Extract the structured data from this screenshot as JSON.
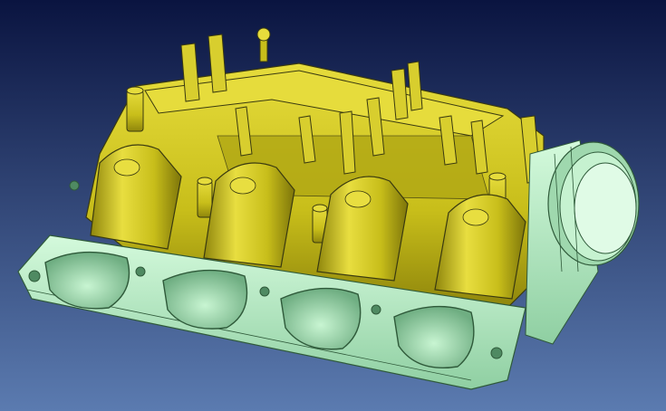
{
  "scene": {
    "subject": "intake-manifold-cad-model",
    "background_top": "#0a1440",
    "background_bottom": "#5b7bb0",
    "plastic_color": "#c8be1a",
    "plastic_shade": "#8f860c",
    "plastic_light": "#e6dc3c",
    "flange_color": "#b9f0c6",
    "flange_shade": "#7fc494",
    "edge_color": "#3a3a10"
  }
}
